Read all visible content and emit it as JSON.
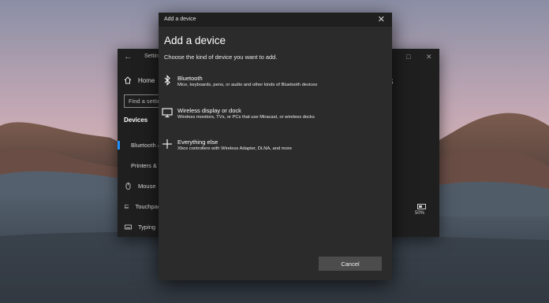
{
  "settings_window": {
    "title": "Settings",
    "home_label": "Home",
    "search_placeholder": "Find a setting",
    "section_title": "Devices",
    "nav_items": [
      {
        "label": "Bluetooth & other devices",
        "icon": "bluetooth-devices-icon",
        "active": true
      },
      {
        "label": "Printers & scanners",
        "icon": "printer-icon",
        "active": false
      },
      {
        "label": "Mouse",
        "icon": "mouse-icon",
        "active": false
      },
      {
        "label": "Touchpad",
        "icon": "touchpad-icon",
        "active": false
      },
      {
        "label": "Typing",
        "icon": "keyboard-icon",
        "active": false
      }
    ],
    "right_heading_fragment": "s",
    "battery_percent": "50%"
  },
  "dialog": {
    "titlebar_text": "Add a device",
    "heading": "Add a device",
    "subtitle": "Choose the kind of device you want to add.",
    "options": [
      {
        "title": "Bluetooth",
        "description": "Mice, keyboards, pens, or audio and other kinds of Bluetooth devices",
        "icon": "bluetooth-icon"
      },
      {
        "title": "Wireless display or dock",
        "description": "Wireless monitors, TVs, or PCs that use Miracast, or wireless docks",
        "icon": "monitor-icon"
      },
      {
        "title": "Everything else",
        "description": "Xbox controllers with Wireless Adapter, DLNA, and more",
        "icon": "plus-icon"
      }
    ],
    "cancel_label": "Cancel"
  },
  "colors": {
    "accent": "#1e90ff",
    "dialog_bg": "#2b2b2b",
    "settings_bg": "#1f1f1f",
    "button_bg": "#4c4c4c"
  }
}
